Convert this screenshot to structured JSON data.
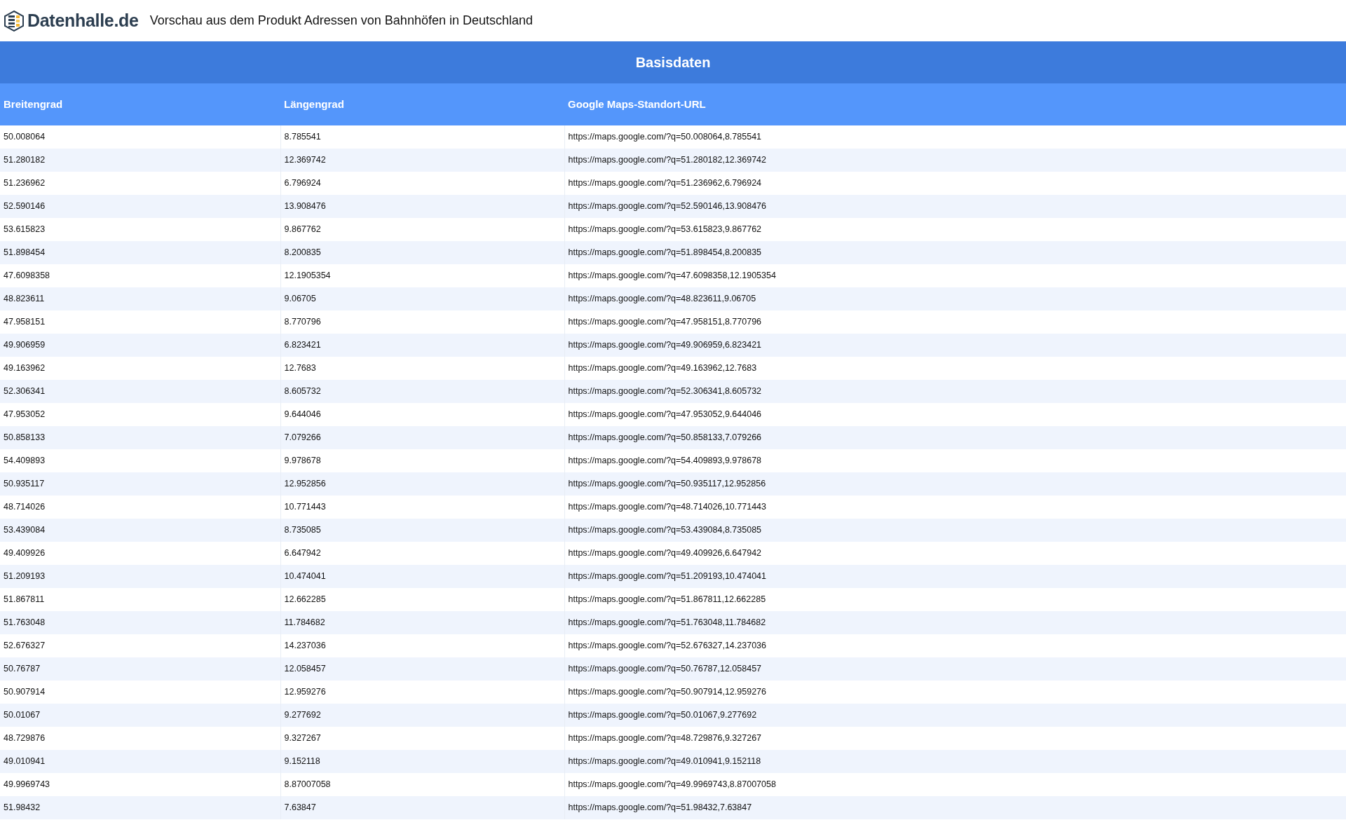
{
  "header": {
    "logo_text": "Datenhalle.de",
    "title": "Vorschau aus dem Produkt Adressen von Bahnhöfen in Deutschland"
  },
  "table": {
    "title": "Basisdaten",
    "columns": [
      "Breitengrad",
      "Längengrad",
      "Google Maps-Standort-URL"
    ],
    "rows": [
      [
        "50.008064",
        "8.785541",
        "https://maps.google.com/?q=50.008064,8.785541"
      ],
      [
        "51.280182",
        "12.369742",
        "https://maps.google.com/?q=51.280182,12.369742"
      ],
      [
        "51.236962",
        "6.796924",
        "https://maps.google.com/?q=51.236962,6.796924"
      ],
      [
        "52.590146",
        "13.908476",
        "https://maps.google.com/?q=52.590146,13.908476"
      ],
      [
        "53.615823",
        "9.867762",
        "https://maps.google.com/?q=53.615823,9.867762"
      ],
      [
        "51.898454",
        "8.200835",
        "https://maps.google.com/?q=51.898454,8.200835"
      ],
      [
        "47.6098358",
        "12.1905354",
        "https://maps.google.com/?q=47.6098358,12.1905354"
      ],
      [
        "48.823611",
        "9.06705",
        "https://maps.google.com/?q=48.823611,9.06705"
      ],
      [
        "47.958151",
        "8.770796",
        "https://maps.google.com/?q=47.958151,8.770796"
      ],
      [
        "49.906959",
        "6.823421",
        "https://maps.google.com/?q=49.906959,6.823421"
      ],
      [
        "49.163962",
        "12.7683",
        "https://maps.google.com/?q=49.163962,12.7683"
      ],
      [
        "52.306341",
        "8.605732",
        "https://maps.google.com/?q=52.306341,8.605732"
      ],
      [
        "47.953052",
        "9.644046",
        "https://maps.google.com/?q=47.953052,9.644046"
      ],
      [
        "50.858133",
        "7.079266",
        "https://maps.google.com/?q=50.858133,7.079266"
      ],
      [
        "54.409893",
        "9.978678",
        "https://maps.google.com/?q=54.409893,9.978678"
      ],
      [
        "50.935117",
        "12.952856",
        "https://maps.google.com/?q=50.935117,12.952856"
      ],
      [
        "48.714026",
        "10.771443",
        "https://maps.google.com/?q=48.714026,10.771443"
      ],
      [
        "53.439084",
        "8.735085",
        "https://maps.google.com/?q=53.439084,8.735085"
      ],
      [
        "49.409926",
        "6.647942",
        "https://maps.google.com/?q=49.409926,6.647942"
      ],
      [
        "51.209193",
        "10.474041",
        "https://maps.google.com/?q=51.209193,10.474041"
      ],
      [
        "51.867811",
        "12.662285",
        "https://maps.google.com/?q=51.867811,12.662285"
      ],
      [
        "51.763048",
        "11.784682",
        "https://maps.google.com/?q=51.763048,11.784682"
      ],
      [
        "52.676327",
        "14.237036",
        "https://maps.google.com/?q=52.676327,14.237036"
      ],
      [
        "50.76787",
        "12.058457",
        "https://maps.google.com/?q=50.76787,12.058457"
      ],
      [
        "50.907914",
        "12.959276",
        "https://maps.google.com/?q=50.907914,12.959276"
      ],
      [
        "50.01067",
        "9.277692",
        "https://maps.google.com/?q=50.01067,9.277692"
      ],
      [
        "48.729876",
        "9.327267",
        "https://maps.google.com/?q=48.729876,9.327267"
      ],
      [
        "49.010941",
        "9.152118",
        "https://maps.google.com/?q=49.010941,9.152118"
      ],
      [
        "49.9969743",
        "8.87007058",
        "https://maps.google.com/?q=49.9969743,8.87007058"
      ],
      [
        "51.98432",
        "7.63847",
        "https://maps.google.com/?q=51.98432,7.63847"
      ]
    ]
  }
}
